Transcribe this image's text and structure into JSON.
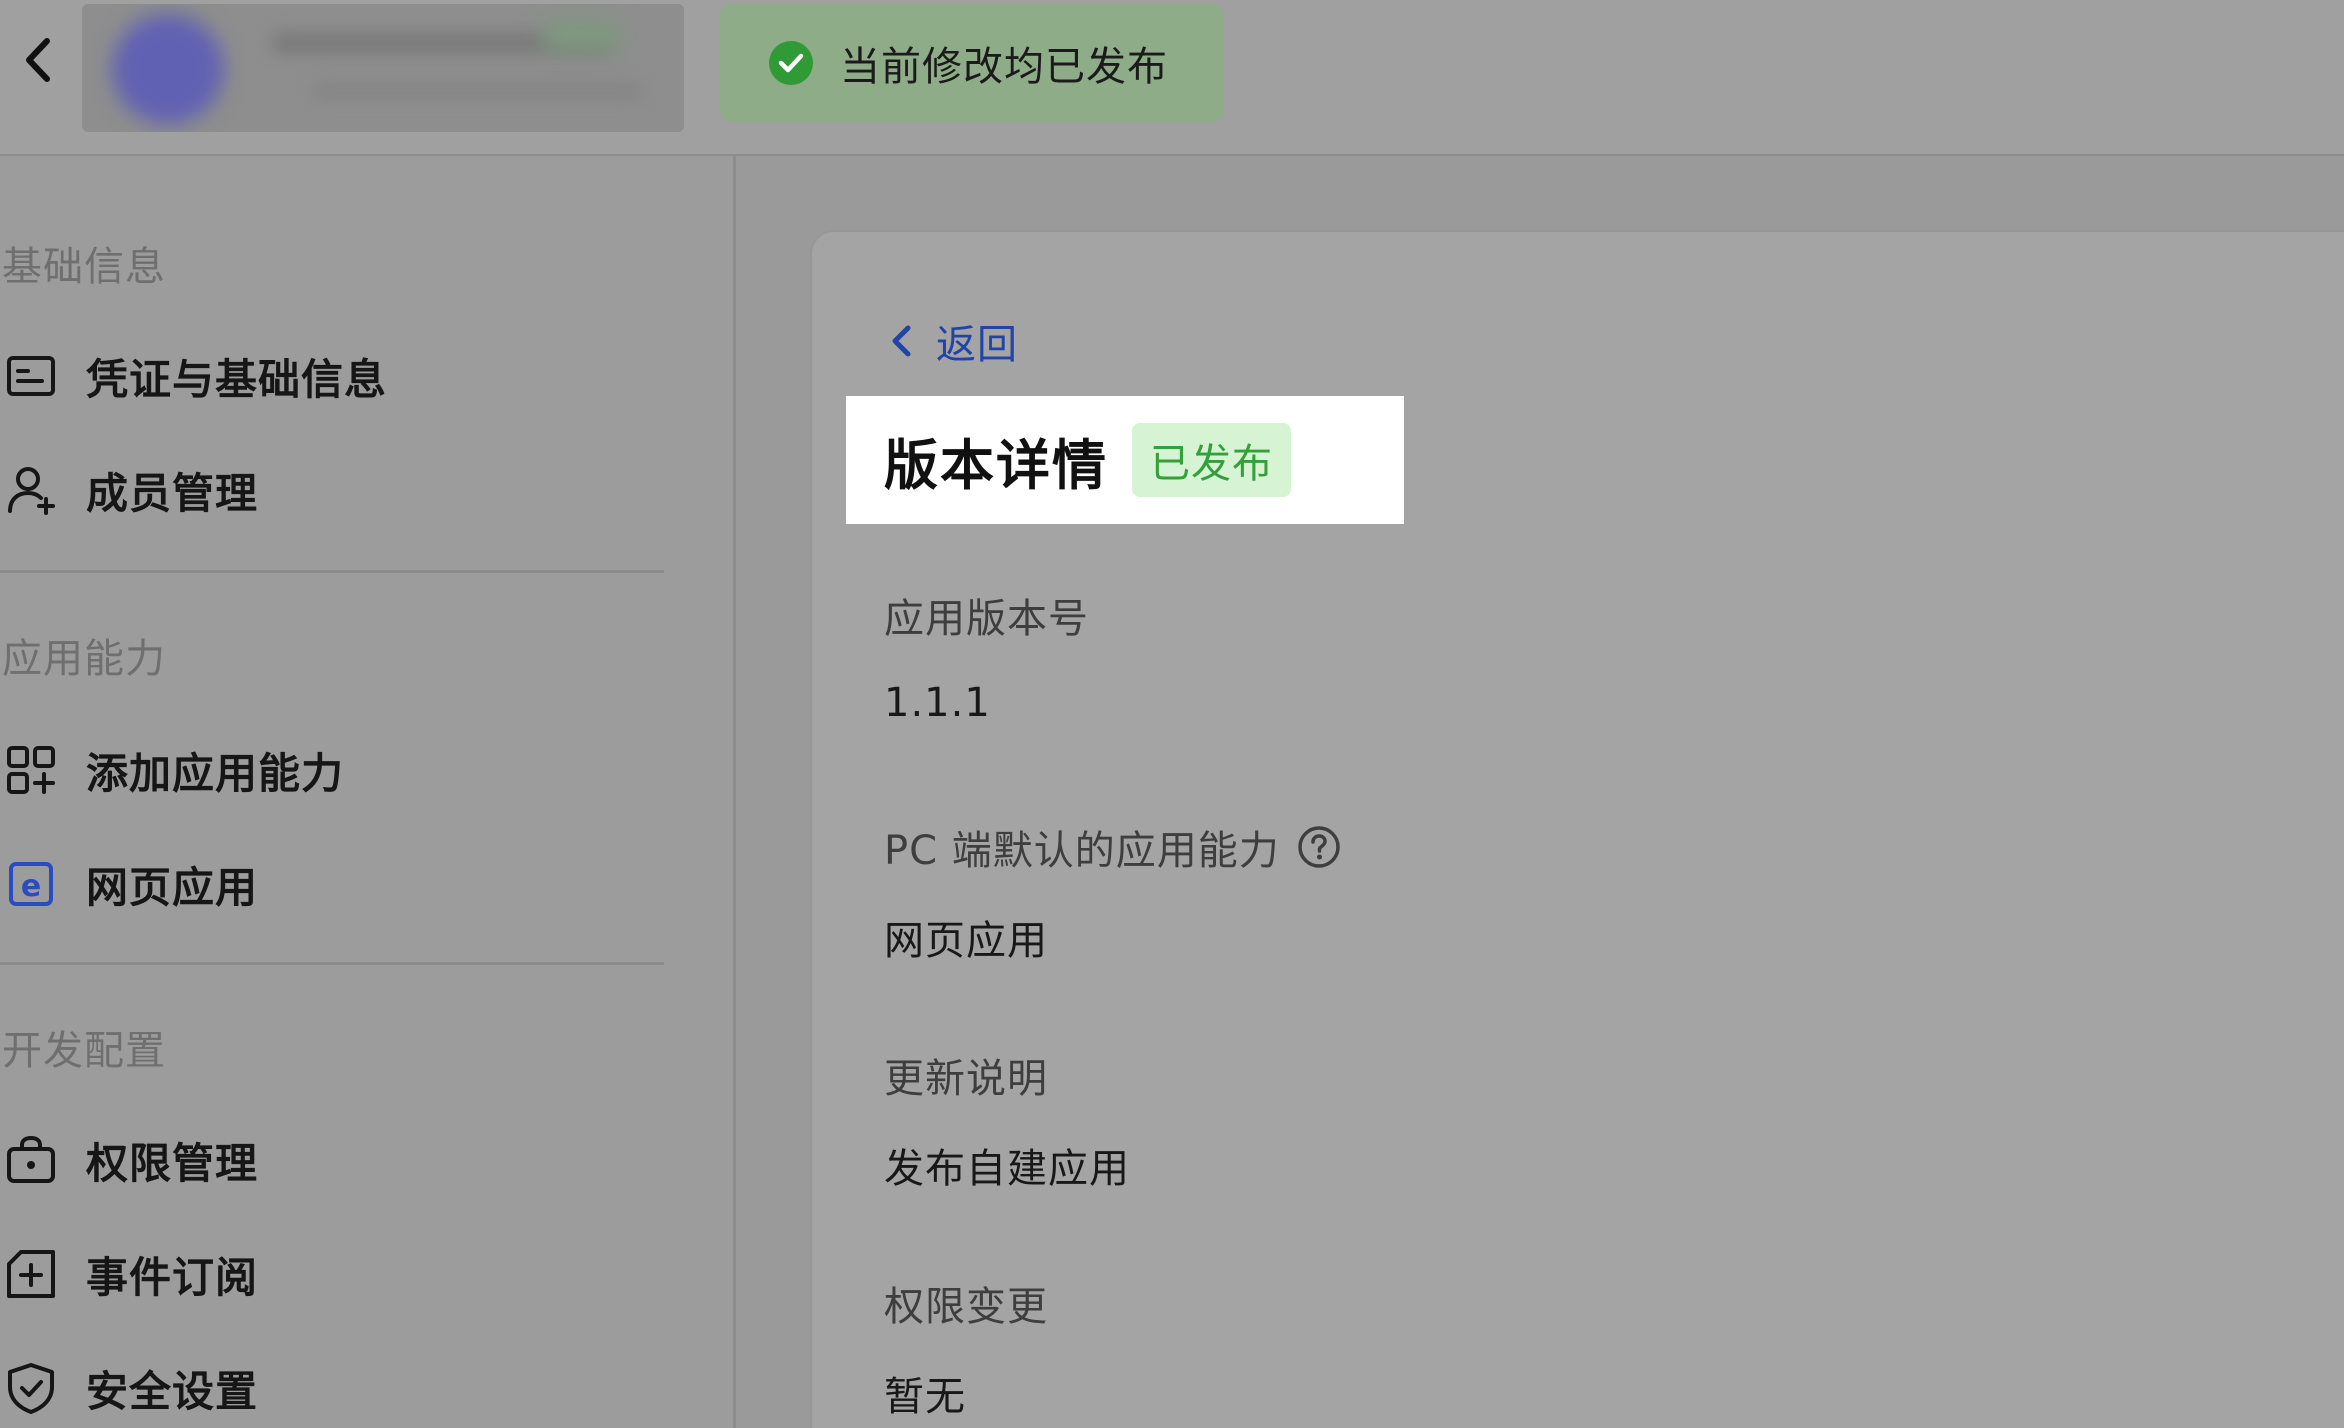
{
  "toast": {
    "text": "当前修改均已发布",
    "icon": "check-circle-icon",
    "color": "#3aa43a"
  },
  "sidebar": {
    "sections": [
      {
        "title": "基础信息",
        "items": [
          {
            "label": "凭证与基础信息",
            "icon": "credential-card-icon"
          },
          {
            "label": "成员管理",
            "icon": "user-add-icon"
          }
        ]
      },
      {
        "title": "应用能力",
        "items": [
          {
            "label": "添加应用能力",
            "icon": "grid-add-icon"
          },
          {
            "label": "网页应用",
            "icon": "web-app-icon"
          }
        ]
      },
      {
        "title": "开发配置",
        "items": [
          {
            "label": "权限管理",
            "icon": "lock-bag-icon"
          },
          {
            "label": "事件订阅",
            "icon": "event-add-icon"
          },
          {
            "label": "安全设置",
            "icon": "shield-icon"
          }
        ]
      }
    ]
  },
  "main": {
    "back_label": "返回",
    "title": "版本详情",
    "status_badge": "已发布",
    "fields": [
      {
        "label": "应用版本号",
        "value": "1.1.1"
      },
      {
        "label": "PC 端默认的应用能力",
        "value": "网页应用",
        "has_help": true
      },
      {
        "label": "更新说明",
        "value": "发布自建应用"
      },
      {
        "label": "权限变更",
        "value": "暂无"
      }
    ]
  },
  "colors": {
    "accent_link": "#2244a8",
    "badge_bg": "#d6f3d4",
    "badge_text": "#34a03a",
    "web_app_icon": "#2a4cc0"
  }
}
